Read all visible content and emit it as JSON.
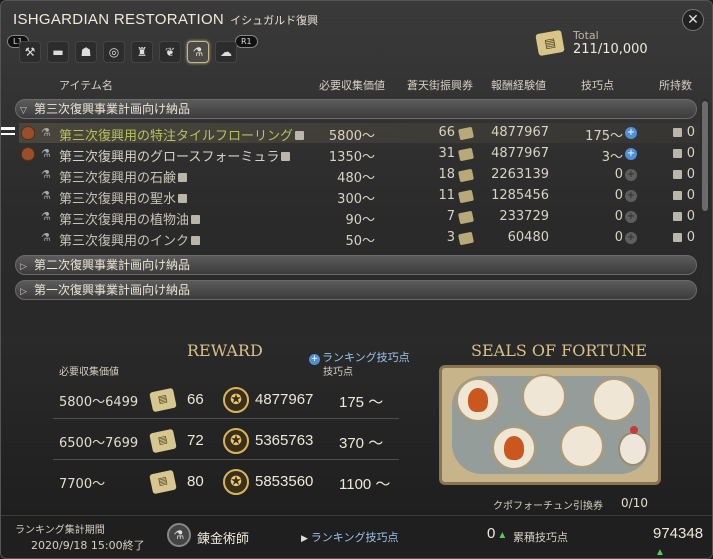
{
  "window": {
    "title": "ISHGARDIAN RESTORATION",
    "subtitle": "イシュガルド復興",
    "close_icon": "crossed-tools-icon"
  },
  "buttons": {
    "l1": "L1",
    "r1": "R1"
  },
  "tabs": [
    {
      "icon": "hammer-icon",
      "glyph": "⚒"
    },
    {
      "icon": "anvil-icon",
      "glyph": "▬"
    },
    {
      "icon": "helmet-icon",
      "glyph": "☗"
    },
    {
      "icon": "ring-icon",
      "glyph": "◎"
    },
    {
      "icon": "loom-icon",
      "glyph": "♜"
    },
    {
      "icon": "leather-icon",
      "glyph": "❦"
    },
    {
      "icon": "alchemy-icon",
      "glyph": "⚗"
    },
    {
      "icon": "cooking-icon",
      "glyph": "☁"
    }
  ],
  "total": {
    "label": "Total",
    "value": "211/10,000"
  },
  "columns": {
    "item": "アイテム名",
    "req": "必要収集価値",
    "scrip": "蒼天街振興券",
    "exp": "報酬経験値",
    "skill": "技巧点",
    "owned": "所持数"
  },
  "categories": [
    {
      "label": "第三次復興事業計画向け納品",
      "open": true
    },
    {
      "label": "第二次復興事業計画向け納品",
      "open": false
    },
    {
      "label": "第一次復興事業計画向け納品",
      "open": false
    }
  ],
  "items": [
    {
      "name": "第三次復興用の特注タイルフローリング",
      "req": "5800～",
      "scrip": "66",
      "exp": "4877967",
      "skill": "175～",
      "owned": "0"
    },
    {
      "name": "第三次復興用のグロースフォーミュラ",
      "req": "1350～",
      "scrip": "31",
      "exp": "4877967",
      "skill": "3～",
      "owned": "0"
    },
    {
      "name": "第三次復興用の石鹸",
      "req": "480～",
      "scrip": "18",
      "exp": "2263139",
      "skill": "0",
      "owned": "0"
    },
    {
      "name": "第三次復興用の聖水",
      "req": "300～",
      "scrip": "11",
      "exp": "1285456",
      "skill": "0",
      "owned": "0"
    },
    {
      "name": "第三次復興用の植物油",
      "req": "90～",
      "scrip": "7",
      "exp": "233729",
      "skill": "0",
      "owned": "0"
    },
    {
      "name": "第三次復興用のインク",
      "req": "50～",
      "scrip": "3",
      "exp": "60480",
      "skill": "0",
      "owned": "0"
    }
  ],
  "reward": {
    "title": "REWARD",
    "req_label": "必要収集価値",
    "rank_link": "ランキング技巧点",
    "skill_label": "技巧点",
    "rows": [
      {
        "range": "5800～6499",
        "scrip": "66",
        "exp": "4877967",
        "skill": "175 ～"
      },
      {
        "range": "6500～7699",
        "scrip": "72",
        "exp": "5365763",
        "skill": "370 ～"
      },
      {
        "range": "7700～",
        "scrip": "80",
        "exp": "5853560",
        "skill": "1100 ～"
      }
    ]
  },
  "seals": {
    "title": "SEALS OF FORTUNE",
    "caption": "クポフォーチュン引換券",
    "count": "0/10"
  },
  "footer": {
    "period_label": "ランキング集計期間",
    "period_date": "2020/9/18 15:00終了",
    "job": "錬金術師",
    "rank_label": "ランキング技巧点",
    "rank_value": "0",
    "acc_label": "累積技巧点",
    "acc_value": "974348"
  },
  "colors": {
    "gold_title": "#d9c18a",
    "link_blue": "#9ec4ef",
    "selected_name": "#b7c35c"
  }
}
